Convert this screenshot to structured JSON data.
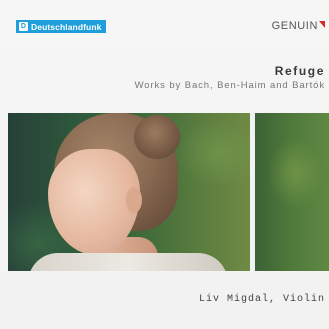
{
  "broadcaster": {
    "logo_text": "Deutschlandfunk",
    "logo_glyph": "D",
    "icon": "deutschlandfunk-logo-icon",
    "color": "#1e9fdc"
  },
  "label": {
    "name": "GENUIN",
    "icon": "genuin-flag-icon",
    "flag_color": "#d42b28"
  },
  "album": {
    "title": "Refuge",
    "subtitle": "Works by Bach, Ben-Haim and Bartók"
  },
  "artist": {
    "credit": "Liv Migdal, Violin"
  }
}
